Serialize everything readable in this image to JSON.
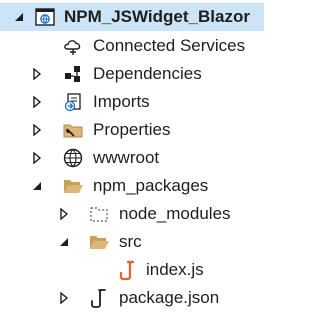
{
  "tree": {
    "project": {
      "label": "NPM_JSWidget_Blazor",
      "icon": "web-project-icon",
      "expanded": true
    },
    "connected_services": {
      "label": "Connected Services",
      "icon": "connected-services-icon"
    },
    "dependencies": {
      "label": "Dependencies",
      "icon": "dependencies-icon",
      "expanded": false
    },
    "imports": {
      "label": "Imports",
      "icon": "imports-icon",
      "expanded": false
    },
    "properties": {
      "label": "Properties",
      "icon": "properties-folder-icon",
      "expanded": false
    },
    "wwwroot": {
      "label": "wwwroot",
      "icon": "globe-icon",
      "expanded": false
    },
    "npm_packages": {
      "label": "npm_packages",
      "icon": "folder-open-icon",
      "expanded": true
    },
    "node_modules": {
      "label": "node_modules",
      "icon": "excluded-folder-icon",
      "expanded": false
    },
    "src": {
      "label": "src",
      "icon": "folder-open-icon",
      "expanded": true
    },
    "index_js": {
      "label": "index.js",
      "icon": "js-file-icon"
    },
    "package_json": {
      "label": "package.json",
      "icon": "json-file-icon",
      "expanded": false
    }
  },
  "colors": {
    "selection": "#cce4f7",
    "folder": "#dcb67a",
    "js": "#e8602c",
    "globe": "#1e1e1e"
  }
}
